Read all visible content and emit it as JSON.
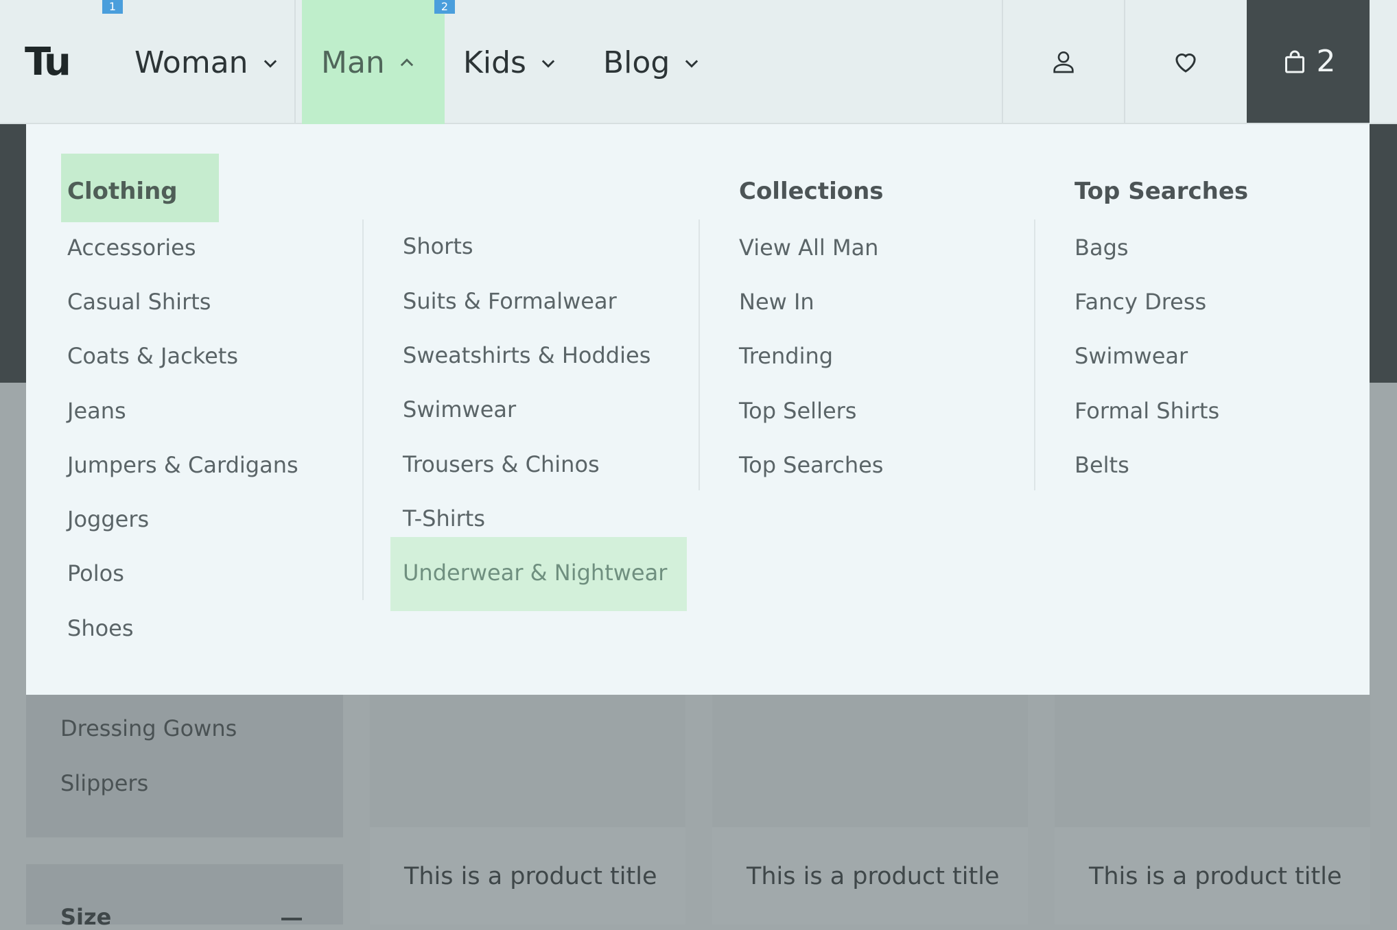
{
  "header": {
    "logo": "Tu",
    "nav": [
      {
        "label": "Woman",
        "marker": "1"
      },
      {
        "label": "Man",
        "marker": "2"
      },
      {
        "label": "Kids"
      },
      {
        "label": "Blog"
      }
    ],
    "cart_count": "2",
    "icons": {
      "account": "user-icon",
      "wishlist": "heart-icon",
      "cart": "bag-icon"
    }
  },
  "menu": {
    "col1_title": "Clothing",
    "col1": [
      "Accessories",
      "Casual Shirts",
      "Coats & Jackets",
      "Jeans",
      "Jumpers & Cardigans",
      "Joggers",
      "Polos",
      "Shoes"
    ],
    "col2": [
      "Shorts",
      "Suits & Formalwear",
      "Sweatshirts & Hoddies",
      "Swimwear",
      "Trousers & Chinos",
      "T-Shirts",
      "Underwear & Nightwear"
    ],
    "col3_title": "Collections",
    "col3": [
      "View All Man",
      "New In",
      "Trending",
      "Top Sellers",
      "Top Searches"
    ],
    "col4_title": "Top Searches",
    "col4": [
      "Bags",
      "Fancy Dress",
      "Swimwear",
      "Formal Shirts",
      "Belts"
    ]
  },
  "sidebar": {
    "filter_links": [
      "Dressing Gowns",
      "Slippers"
    ],
    "size_title": "Size"
  },
  "products": [
    {
      "title": "This is a product title"
    },
    {
      "title": "This is a product title"
    },
    {
      "title": "This is a product title"
    }
  ],
  "colors": {
    "highlight": "#bfeecb",
    "cart_bg": "#434b4d",
    "menu_bg": "#eff6f8"
  }
}
